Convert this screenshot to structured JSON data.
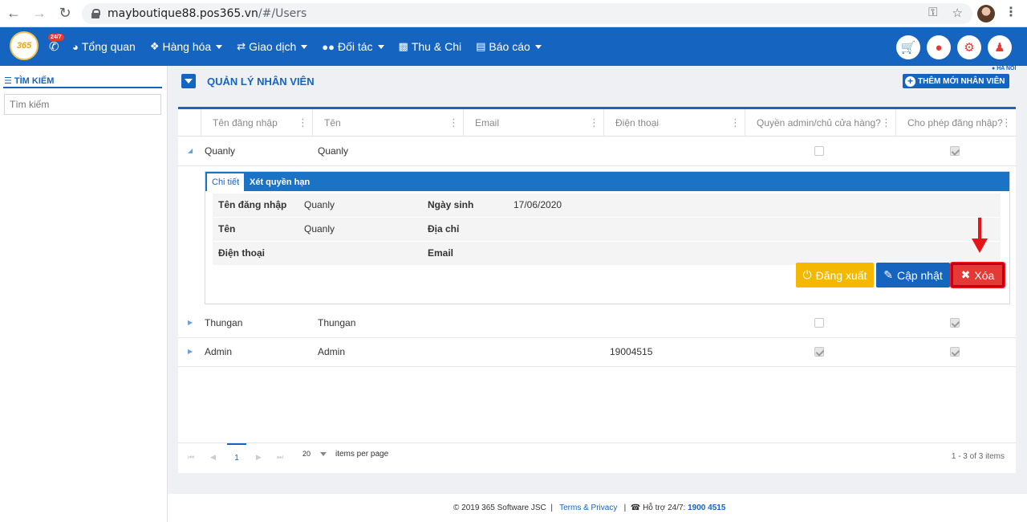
{
  "browser": {
    "url_host": "mayboutique88.pos365.vn",
    "url_path": "/#/Users"
  },
  "app": {
    "logo_text": "365",
    "badge": "24/7",
    "menu": [
      {
        "label": "Tổng quan",
        "icon": "dashboard-icon",
        "dropdown": false
      },
      {
        "label": "Hàng hóa",
        "icon": "cubes-icon",
        "dropdown": true
      },
      {
        "label": "Giao dịch",
        "icon": "exchange-icon",
        "dropdown": true
      },
      {
        "label": "Đối tác",
        "icon": "users-icon",
        "dropdown": true
      },
      {
        "label": "Thu & Chi",
        "icon": "money-icon",
        "dropdown": false
      },
      {
        "label": "Báo cáo",
        "icon": "bar-chart-icon",
        "dropdown": true
      }
    ],
    "region": "HA NOI"
  },
  "sidebar": {
    "title": "TÌM KIẾM",
    "search_placeholder": "Tìm kiếm"
  },
  "main": {
    "title": "QUẢN LÝ NHÂN VIÊN",
    "add_button": "THÊM MỚI NHÂN VIÊN"
  },
  "table": {
    "columns": [
      "Tên đăng nhập",
      "Tên",
      "Email",
      "Điện thoại",
      "Quyền admin/chủ cửa hàng?",
      "Cho phép đăng nhập?"
    ],
    "rows": [
      {
        "username": "Quanly",
        "name": "Quanly",
        "email": "",
        "phone": "",
        "is_admin": false,
        "can_login": true
      },
      {
        "username": "Thungan",
        "name": "Thungan",
        "email": "",
        "phone": "",
        "is_admin": false,
        "can_login": true
      },
      {
        "username": "Admin",
        "name": "Admin",
        "email": "",
        "phone": "19004515",
        "is_admin": true,
        "can_login": true
      }
    ]
  },
  "detail": {
    "tabs": [
      "Chi tiết",
      "Xét quyền hạn"
    ],
    "fields": {
      "username_label": "Tên đăng nhập",
      "username": "Quanly",
      "birthday_label": "Ngày sinh",
      "birthday": "17/06/2020",
      "name_label": "Tên",
      "name": "Quanly",
      "address_label": "Địa chỉ",
      "address": "",
      "phone_label": "Điện thoại",
      "phone": "",
      "email_label": "Email",
      "email": ""
    },
    "buttons": {
      "logout": "Đăng xuất",
      "update": "Cập nhật",
      "delete": "Xóa"
    }
  },
  "pager": {
    "current_page": "1",
    "page_size": "20",
    "per_page_label": "items per page",
    "count": "1 - 3 of 3 items"
  },
  "footer": {
    "copyright": "© 2019 365 Software JSC",
    "terms": "Terms & Privacy",
    "support_label": "Hỗ trợ 24/7:",
    "support_phone": "1900 4515"
  },
  "colors": {
    "primary": "#1565c0",
    "danger": "#e53935",
    "warning": "#f5b800"
  }
}
